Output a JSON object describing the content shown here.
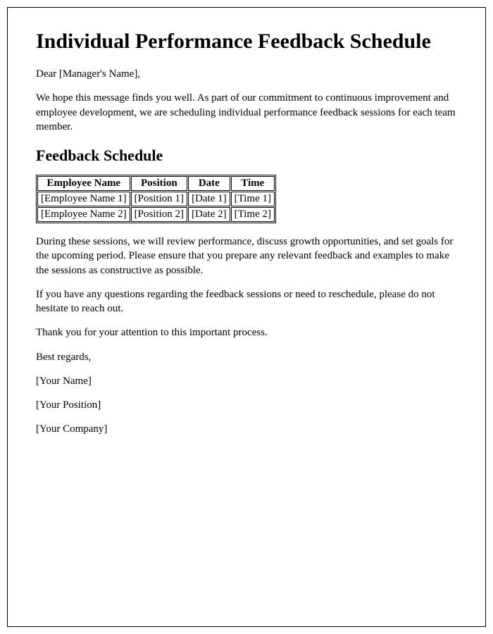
{
  "heading": "Individual Performance Feedback Schedule",
  "greeting": "Dear [Manager's Name],",
  "intro": "We hope this message finds you well. As part of our commitment to continuous improvement and employee development, we are scheduling individual performance feedback sessions for each team member.",
  "schedule_heading": "Feedback Schedule",
  "table": {
    "headers": [
      "Employee Name",
      "Position",
      "Date",
      "Time"
    ],
    "rows": [
      [
        "[Employee Name 1]",
        "[Position 1]",
        "[Date 1]",
        "[Time 1]"
      ],
      [
        "[Employee Name 2]",
        "[Position 2]",
        "[Date 2]",
        "[Time 2]"
      ]
    ]
  },
  "body1": "During these sessions, we will review performance, discuss growth opportunities, and set goals for the upcoming period. Please ensure that you prepare any relevant feedback and examples to make the sessions as constructive as possible.",
  "body2": "If you have any questions regarding the feedback sessions or need to reschedule, please do not hesitate to reach out.",
  "thanks": "Thank you for your attention to this important process.",
  "closing": "Best regards,",
  "signature_name": "[Your Name]",
  "signature_position": "[Your Position]",
  "signature_company": "[Your Company]"
}
